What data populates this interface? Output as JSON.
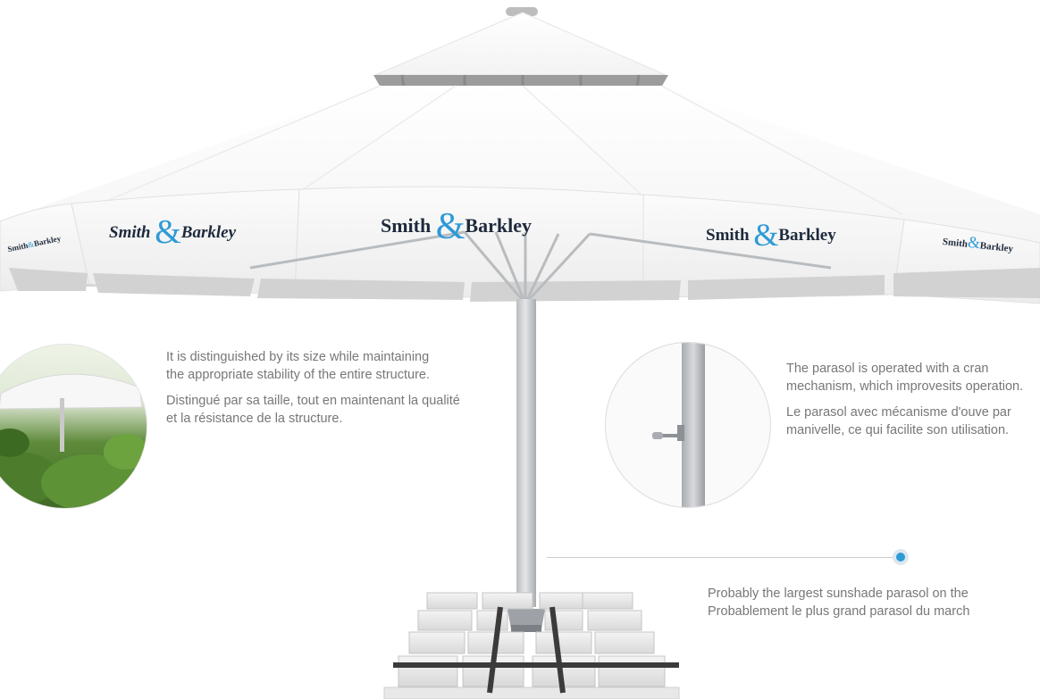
{
  "brand": {
    "name_left": "Smith",
    "ampersand": "&",
    "name_right": "Barkley"
  },
  "features": {
    "size": {
      "en": "It is distinguished by its size while maintaining the appropriate stability of the entire structure.",
      "fr": "Distingué par sa taille, tout en maintenant la qualité et la résistance de la structure."
    },
    "crank": {
      "en": "The parasol is operated with a cran mechanism, which improvesits operation.",
      "fr": "Le parasol avec mécanisme d'ouve par manivelle, ce qui facilite son utilisation."
    },
    "largest": {
      "en": "Probably the largest sunshade parasol on the",
      "fr": "Probablement le plus grand parasol du march"
    }
  },
  "colors": {
    "accent": "#2e9ad6",
    "brand_text": "#1e2a3c",
    "body_text": "#777777"
  }
}
